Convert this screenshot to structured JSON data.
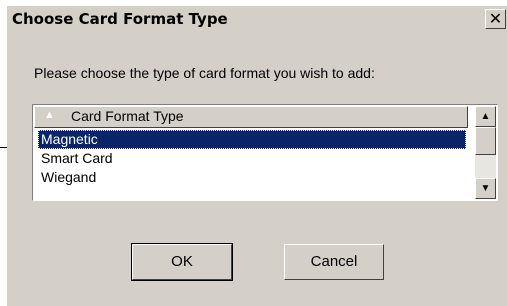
{
  "window": {
    "title": "Choose Card Format Type",
    "close_glyph": "✕"
  },
  "prompt": "Please choose the type of card format you wish to add:",
  "list": {
    "column_header": "Card Format Type",
    "sort_glyph": "▲",
    "items": [
      "Magnetic",
      "Smart Card",
      "Wiegand"
    ],
    "selected_index": 0
  },
  "scrollbar": {
    "up_glyph": "▲",
    "down_glyph": "▼"
  },
  "buttons": {
    "ok": "OK",
    "cancel": "Cancel"
  }
}
